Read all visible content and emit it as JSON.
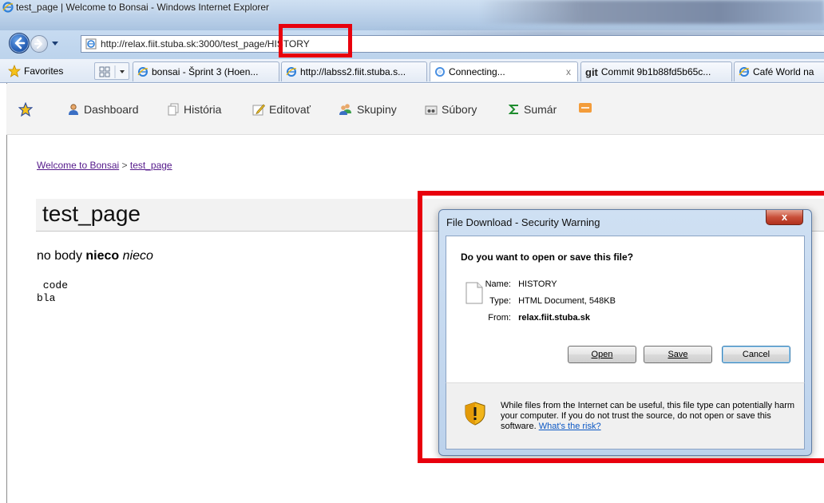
{
  "window": {
    "title": "test_page | Welcome to Bonsai - Windows Internet Explorer",
    "address": "http://relax.fiit.stuba.sk:3000/test_page/HISTORY"
  },
  "tabs_bar": {
    "favorites_label": "Favorites",
    "tabs": [
      {
        "label": "bonsai - Šprint 3 (Hoen...",
        "icon": "ie-page-icon"
      },
      {
        "label": "http://labss2.fiit.stuba.s...",
        "icon": "ie-page-icon"
      },
      {
        "label": "Connecting...",
        "icon": "loading-icon",
        "close": "x"
      },
      {
        "label": "Commit 9b1b88fd5b65c...",
        "prefix": "git",
        "icon": "git-icon"
      },
      {
        "label": "Café World na",
        "icon": "ie-page-icon"
      }
    ]
  },
  "toolbar": {
    "items": [
      {
        "label": "Dashboard",
        "icon": "user-icon"
      },
      {
        "label": "História",
        "icon": "history-icon"
      },
      {
        "label": "Editovať",
        "icon": "pencil-icon"
      },
      {
        "label": "Skupiny",
        "icon": "group-icon"
      },
      {
        "label": "Súbory",
        "icon": "files-icon"
      },
      {
        "label": "Sumár",
        "icon": "sigma-icon"
      },
      {
        "label": "",
        "icon": "rss-icon"
      }
    ]
  },
  "breadcrumb": {
    "root": "Welcome to Bonsai",
    "separator": ">",
    "current": "test_page"
  },
  "page": {
    "title": "test_page",
    "body_plain": "no body",
    "body_bold": "nieco",
    "body_italic": "nieco",
    "code_lines": [
      " code",
      "bla"
    ]
  },
  "dialog": {
    "title": "File Download - Security Warning",
    "close_label": "x",
    "question": "Do you want to open or save this file?",
    "name_label": "Name:",
    "name_value": "HISTORY",
    "type_label": "Type:",
    "type_value": "HTML Document, 548KB",
    "from_label": "From:",
    "from_value": "relax.fiit.stuba.sk",
    "open_label": "Open",
    "save_label": "Save",
    "cancel_label": "Cancel",
    "warning": "While files from the Internet can be useful, this file type can potentially harm your computer. If you do not trust the source, do not open or save this software.",
    "risk_link": "What's the risk?"
  },
  "colors": {
    "highlight": "#e8000d",
    "link_visited": "#551a8b",
    "link": "#0b57c4"
  }
}
